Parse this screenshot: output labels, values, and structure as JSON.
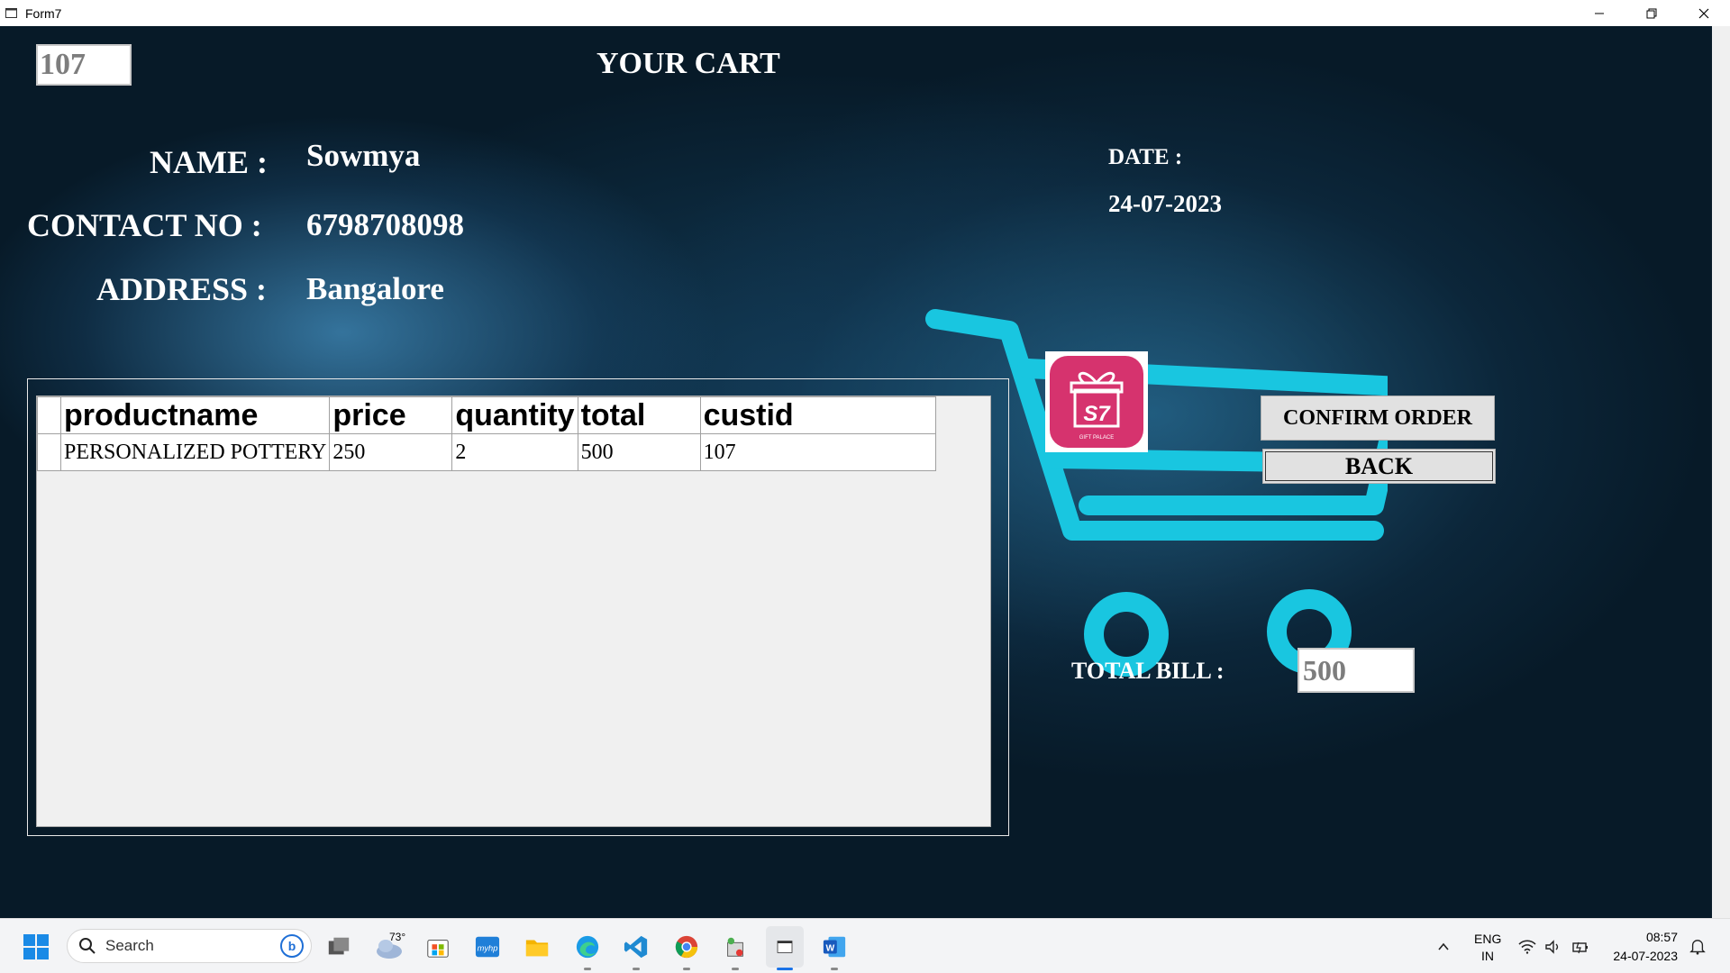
{
  "window": {
    "title": "Form7"
  },
  "form": {
    "customer_id": "107",
    "heading": "YOUR CART",
    "labels": {
      "name": "NAME :",
      "contact": "CONTACT NO :",
      "address": "ADDRESS :",
      "date": "DATE :",
      "total_bill": "TOTAL BILL :"
    },
    "values": {
      "name": "Sowmya",
      "contact": "6798708098",
      "address": "Bangalore",
      "date": "24-07-2023",
      "total_bill": "500"
    },
    "grid": {
      "columns": [
        "productname",
        "price",
        "quantity",
        "total",
        "custid"
      ],
      "rows": [
        [
          "PERSONALIZED POTTERY",
          "250",
          "2",
          "500",
          "107"
        ]
      ]
    },
    "buttons": {
      "confirm": "CONFIRM ORDER",
      "back": "BACK"
    },
    "logo_text": "GIFT PALACE",
    "colors": {
      "cart": "#19c6e0",
      "logo": "#d6336e"
    }
  },
  "taskbar": {
    "search_placeholder": "Search",
    "weather_temp": "73°",
    "language_top": "ENG",
    "language_bottom": "IN",
    "time": "08:57",
    "date": "24-07-2023",
    "icons": [
      "windows-start-icon",
      "task-view-icon",
      "weather-icon",
      "store-icon",
      "myhp-icon",
      "file-explorer-icon",
      "edge-icon",
      "vscode-icon",
      "chrome-icon",
      "app-icon",
      "active-app-icon",
      "word-icon"
    ]
  }
}
